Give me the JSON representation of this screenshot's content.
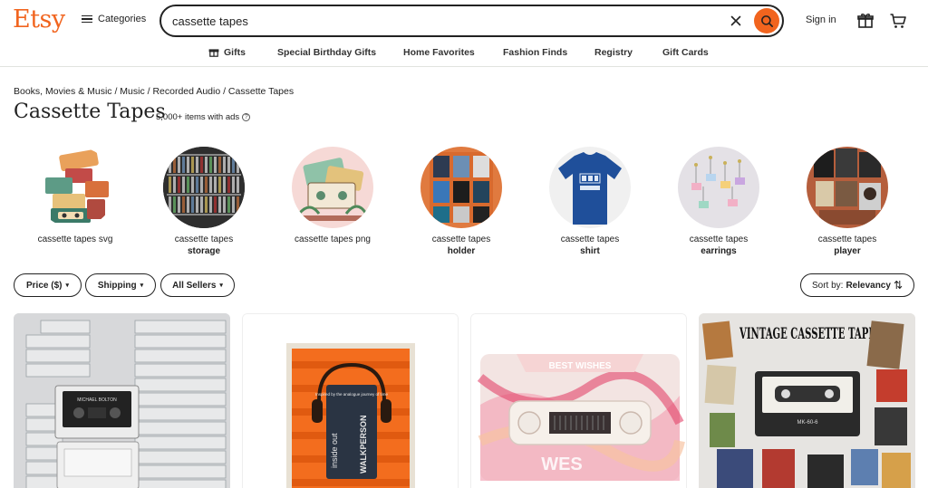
{
  "header": {
    "logo": "Etsy",
    "categories_label": "Categories",
    "search_value": "cassette tapes",
    "signin_label": "Sign in"
  },
  "subnav": {
    "items": [
      "Gifts",
      "Special Birthday Gifts",
      "Home Favorites",
      "Fashion Finds",
      "Registry",
      "Gift Cards"
    ]
  },
  "breadcrumb": "Books, Movies & Music / Music / Recorded Audio / Cassette Tapes",
  "page": {
    "title": "Cassette Tapes",
    "item_count": "5,000+ items with ads",
    "info_glyph": "?"
  },
  "categories": [
    {
      "line1": "cassette tapes svg",
      "line2": ""
    },
    {
      "line1": "cassette tapes",
      "line2": "storage"
    },
    {
      "line1": "cassette tapes png",
      "line2": ""
    },
    {
      "line1": "cassette tapes",
      "line2": "holder"
    },
    {
      "line1": "cassette tapes",
      "line2": "shirt"
    },
    {
      "line1": "cassette tapes",
      "line2": "earrings"
    },
    {
      "line1": "cassette tapes",
      "line2": "player"
    }
  ],
  "filters": {
    "price": "Price ($)",
    "shipping": "Shipping",
    "sellers": "All Sellers",
    "sort_prefix": "Sort by:",
    "sort_value": "Relevancy",
    "caret_glyph": "▾",
    "sort_glyph": "⇅"
  },
  "product_texts": {
    "card1": {
      "label": "MICHAEL BOLTON"
    },
    "card2": {
      "left_text": "inside out",
      "right_text": "WALKPERSON",
      "note": "Inspired by the analogue journey of time"
    },
    "card3": {
      "top_text": "BEST WISHES",
      "bottom_text": "WES"
    },
    "card4": {
      "title": "VINTAGE CASSETTE TAPE",
      "tape_label": "MK-60-6"
    }
  },
  "colors": {
    "brand": "#f1641e",
    "text": "#222222"
  }
}
